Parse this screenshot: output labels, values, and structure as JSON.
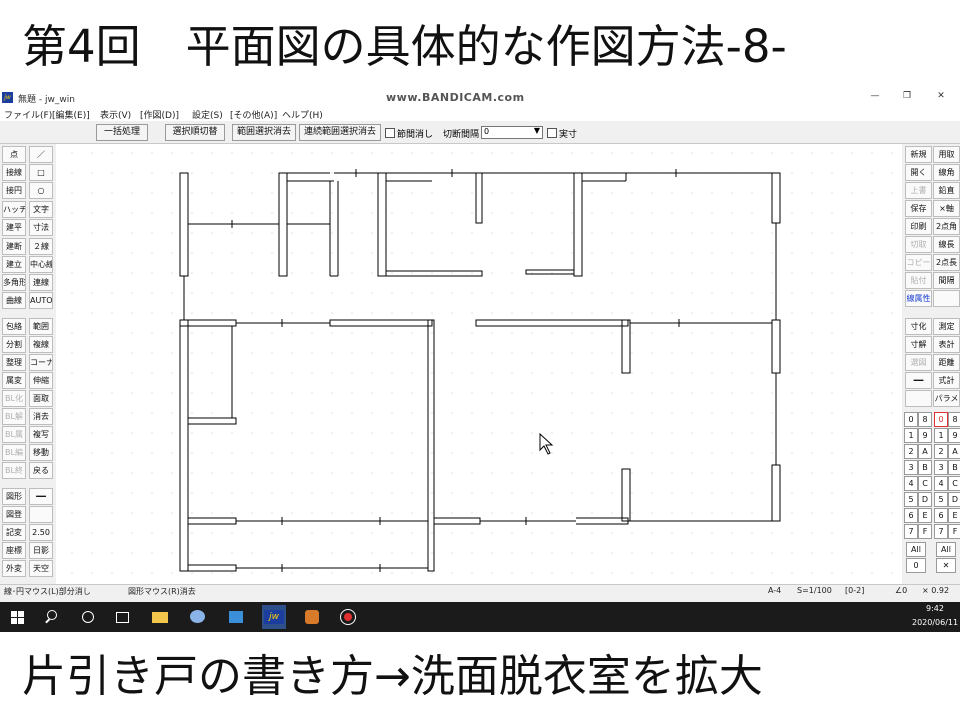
{
  "banner_top": "第4回　平面図の具体的な作図方法-8-",
  "banner_bottom": "片引き戸の書き方→洗面脱衣室を拡大",
  "window": {
    "title": "無題 - jw_win",
    "watermark": "www.BANDICAM.com",
    "controls": [
      "—",
      "❐",
      "✕"
    ]
  },
  "menu": [
    "ファイル(F)",
    "[編集(E)]",
    "表示(V)",
    "[作図(D)]",
    "設定(S)",
    "[その他(A)]",
    "ヘルプ(H)"
  ],
  "toolbar": {
    "buttons": [
      "一括処理",
      "選択順切替",
      "範囲選択消去",
      "連続範囲選択消去"
    ],
    "check1_label": "節間消し",
    "gap_label": "切断間隔",
    "gap_value": "0",
    "check2_label": "実寸"
  },
  "left_tools": [
    [
      "点",
      "／"
    ],
    [
      "接線",
      "□"
    ],
    [
      "接円",
      "○"
    ],
    [
      "ハッチ",
      "文字"
    ],
    [
      "建平",
      "寸法"
    ],
    [
      "建断",
      "２線"
    ],
    [
      "建立",
      "中心線"
    ],
    [
      "多角形",
      "連線"
    ],
    [
      "曲線",
      "AUTO"
    ],
    [
      "包絡",
      "範囲"
    ],
    [
      "分割",
      "複線"
    ],
    [
      "整理",
      "コーナー"
    ],
    [
      "属変",
      "伸縮"
    ],
    [
      "BL化",
      "面取"
    ],
    [
      "BL解",
      "消去"
    ],
    [
      "BL属",
      "複写"
    ],
    [
      "BL編",
      "移動"
    ],
    [
      "BL終",
      "戻る"
    ],
    [
      "図形",
      "━━"
    ],
    [
      "図登",
      ""
    ],
    [
      "記変",
      "2.50"
    ],
    [
      "座標",
      "日影"
    ],
    [
      "外変",
      "天空"
    ]
  ],
  "left_dim": [
    "BL化",
    "BL解",
    "BL属",
    "BL編",
    "BL終"
  ],
  "right_tools": [
    [
      "新規",
      "用取"
    ],
    [
      "開く",
      "線角"
    ],
    [
      "上書",
      "鉛直"
    ],
    [
      "保存",
      "×軸"
    ],
    [
      "印刷",
      "2点角"
    ],
    [
      "切取",
      "線長"
    ],
    [
      "コピー",
      "2点長"
    ],
    [
      "貼付",
      "間隔"
    ],
    [
      "線属性",
      ""
    ],
    [
      "寸化",
      "測定"
    ],
    [
      "寸解",
      "表計"
    ],
    [
      "選図",
      "距離"
    ],
    [
      "━━",
      "式計"
    ],
    [
      "",
      "パラメ"
    ]
  ],
  "right_dim": [
    "上書",
    "切取",
    "コピー",
    "貼付",
    "選図"
  ],
  "layers_left": [
    "0",
    "1",
    "2",
    "3",
    "4",
    "5",
    "6",
    "7"
  ],
  "layers_mid": [
    "8",
    "9",
    "A",
    "B",
    "C",
    "D",
    "E",
    "F"
  ],
  "layers_right_a": [
    "0",
    "1",
    "2",
    "3",
    "4",
    "5",
    "6",
    "7"
  ],
  "layers_right_b": [
    "8",
    "9",
    "A",
    "B",
    "C",
    "D",
    "E",
    "F"
  ],
  "layer_all": "All",
  "layer_zero": "0",
  "layer_x": "✕",
  "status": {
    "hint_left": "線･円マウス(L)部分消し",
    "hint_right": "図形マウス(R)消去",
    "paper": "A-4",
    "scale": "S=1/100",
    "layer": "[0-2]",
    "angle": "∠0",
    "zoom": "× 0.92"
  },
  "clock": {
    "time": "9:42",
    "date": "2020/06/11"
  },
  "colors": {
    "accent_red": "#e03030",
    "line": "#000000",
    "grid": "#cccccc"
  }
}
